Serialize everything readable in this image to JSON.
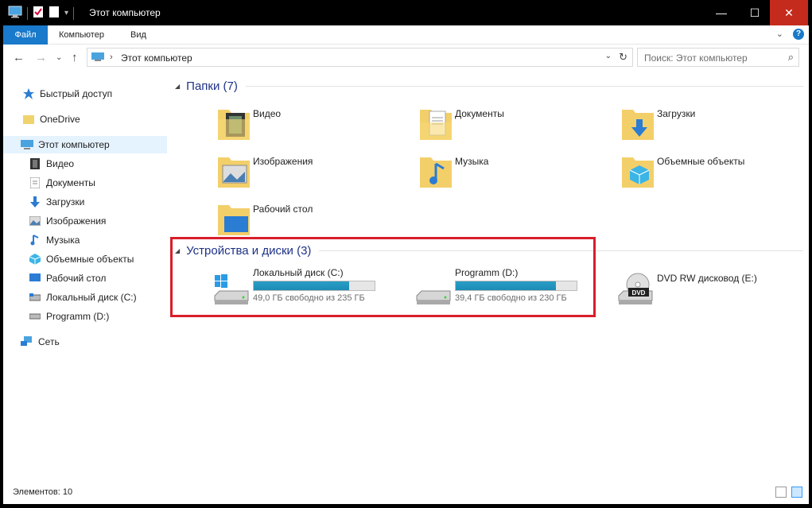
{
  "window": {
    "title": "Этот компьютер",
    "controls": {
      "minimize": "—",
      "maximize": "☐",
      "close": "✕"
    }
  },
  "ribbon": {
    "tabs": [
      {
        "label": "Файл",
        "active": true
      },
      {
        "label": "Компьютер"
      },
      {
        "label": "Вид"
      }
    ],
    "expand": "⌄",
    "help": "?"
  },
  "address": {
    "path": "Этот компьютер",
    "separator": "›",
    "dropdown": "⌄",
    "refresh": "↻"
  },
  "search": {
    "placeholder": "Поиск: Этот компьютер",
    "icon": "⌕"
  },
  "nav": {
    "back": "←",
    "forward": "→",
    "recent": "⌄",
    "up": "↑"
  },
  "sidebar": {
    "items": [
      {
        "label": "Быстрый доступ",
        "icon": "star-icon"
      },
      {
        "label": "OneDrive",
        "icon": "onedrive-folder-icon"
      },
      {
        "label": "Этот компьютер",
        "icon": "computer-icon",
        "selected": true
      },
      {
        "label": "Видео",
        "icon": "video-icon"
      },
      {
        "label": "Документы",
        "icon": "documents-icon"
      },
      {
        "label": "Загрузки",
        "icon": "downloads-icon"
      },
      {
        "label": "Изображения",
        "icon": "pictures-icon"
      },
      {
        "label": "Музыка",
        "icon": "music-icon"
      },
      {
        "label": "Объемные объекты",
        "icon": "3d-objects-icon"
      },
      {
        "label": "Рабочий стол",
        "icon": "desktop-icon"
      },
      {
        "label": "Локальный диск (C:)",
        "icon": "drive-icon"
      },
      {
        "label": "Programm (D:)",
        "icon": "drive-icon"
      },
      {
        "label": "Сеть",
        "icon": "network-icon"
      }
    ]
  },
  "groups": {
    "folders": {
      "title": "Папки (7)",
      "items": [
        {
          "label": "Видео"
        },
        {
          "label": "Документы"
        },
        {
          "label": "Загрузки"
        },
        {
          "label": "Изображения"
        },
        {
          "label": "Музыка"
        },
        {
          "label": "Объемные объекты"
        },
        {
          "label": "Рабочий стол"
        }
      ]
    },
    "devices": {
      "title": "Устройства и диски (3)",
      "items": [
        {
          "label": "Локальный диск (C:)",
          "free": "49,0 ГБ свободно из 235 ГБ",
          "used_fraction": 0.79
        },
        {
          "label": "Programm (D:)",
          "free": "39,4 ГБ свободно из 230 ГБ",
          "used_fraction": 0.83
        },
        {
          "label": "DVD RW дисковод (E:)",
          "badge": "DVD"
        }
      ]
    }
  },
  "status": {
    "count": "Элементов: 10"
  },
  "colors": {
    "accent": "#1979ca",
    "group_title": "#1e3287",
    "highlight": "#d81e2a",
    "bar_fill": "#26a0da"
  }
}
